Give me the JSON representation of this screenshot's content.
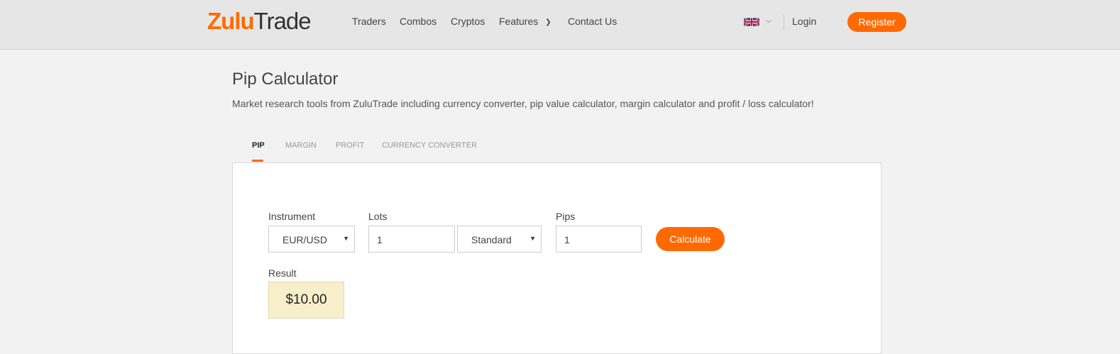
{
  "header": {
    "logo": {
      "part1": "Zulu",
      "part2": "Trade"
    },
    "nav": [
      "Traders",
      "Combos",
      "Cryptos",
      "Features",
      "Contact Us"
    ],
    "login": "Login",
    "register": "Register",
    "accent_color": "#ff6a00"
  },
  "page": {
    "title": "Pip Calculator",
    "subtitle": "Market research tools from ZuluTrade including currency converter, pip value calculator, margin calculator and profit / loss calculator!"
  },
  "tabs": [
    "PIP",
    "MARGIN",
    "PROFIT",
    "CURRENCY CONVERTER"
  ],
  "form": {
    "instrument_label": "Instrument",
    "instrument_value": "EUR/USD",
    "lots_label": "Lots",
    "lots_value": "1",
    "lot_type_value": "Standard",
    "pips_label": "Pips",
    "pips_value": "1",
    "calculate": "Calculate",
    "result_label": "Result",
    "result_value": "$10.00"
  }
}
